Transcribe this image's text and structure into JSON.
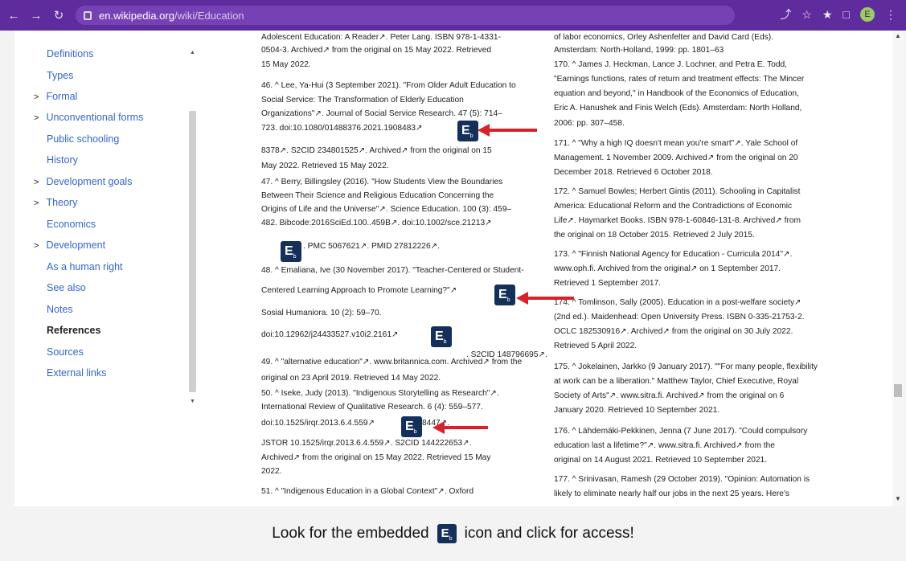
{
  "browser": {
    "url_host": "en.wikipedia.org",
    "url_path": "/wiki/Education",
    "avatar_letter": "E"
  },
  "toc": {
    "items": [
      {
        "label": "Definitions",
        "caret": false,
        "active": false
      },
      {
        "label": "Types",
        "caret": false,
        "active": false
      },
      {
        "label": "Formal",
        "caret": true,
        "active": false
      },
      {
        "label": "Unconventional forms",
        "caret": true,
        "active": false
      },
      {
        "label": "Public schooling",
        "caret": false,
        "active": false
      },
      {
        "label": "History",
        "caret": false,
        "active": false
      },
      {
        "label": "Development goals",
        "caret": true,
        "active": false
      },
      {
        "label": "Theory",
        "caret": true,
        "active": false
      },
      {
        "label": "Economics",
        "caret": false,
        "active": false
      },
      {
        "label": "Development",
        "caret": true,
        "active": false
      },
      {
        "label": "As a human right",
        "caret": false,
        "active": false
      },
      {
        "label": "See also",
        "caret": false,
        "active": false
      },
      {
        "label": "Notes",
        "caret": false,
        "active": false
      },
      {
        "label": "References",
        "caret": false,
        "active": true
      },
      {
        "label": "Sources",
        "caret": false,
        "active": false
      },
      {
        "label": "External links",
        "caret": false,
        "active": false
      }
    ]
  },
  "references": {
    "col1": [
      "Adolescent Education: A Reader↗. Peter Lang. ISBN 978-1-4331-",
      "0504-3. Archived↗ from the original on 15 May 2022. Retrieved",
      "15 May 2022.",
      "46. ^ Lee, Ya-Hui (3 September 2021). \"From Older Adult Education to",
      "Social Service: The Transformation of Elderly Education",
      "Organizations\"↗. Journal of Social Service Research. 47 (5): 714–",
      "723. doi:10.1080/01488376.2021.1908483↗",
      "8378↗. S2CID 234801525↗. Archived↗ from the original on 15",
      "May 2022. Retrieved 15 May 2022.",
      "47. ^ Berry, Billingsley (2016). \"How Students View the Boundaries",
      "Between Their Science and Religious Education Concerning the",
      "Origins of Life and the Universe\"↗. Science Education. 100 (3): 459–",
      "482. Bibcode:2016SciEd.100..459B↗. doi:10.1002/sce.21213↗",
      ". PMC 5067621↗. PMID 27812226↗.",
      "48. ^ Emaliana, Ive (30 November 2017). \"Teacher-Centered or Student-",
      "Centered Learning Approach to Promote Learning?\"↗",
      "Sosial Humaniora. 10 (2): 59–70.",
      "doi:10.12962/j24433527.v10i2.2161↗",
      ". S2CID 148796695↗.",
      "49. ^ \"alternative education\"↗. www.britannica.com. Archived↗ from the",
      "original on 23 April 2019. Retrieved 14 May 2022.",
      "50. ^ Iseke, Judy (2013). \"Indigenous Storytelling as Research\"↗.",
      "International Review of Qualitative Research. 6 (4): 559–577.",
      "doi:10.1525/irqr.2013.6.4.559↗",
      "8447↗.",
      "JSTOR 10.1525/irqr.2013.6.4.559↗. S2CID 144222653↗.",
      "Archived↗ from the original on 15 May 2022. Retrieved 15 May",
      "2022.",
      "51. ^ \"Indigenous Education in a Global Context\"↗. Oxford"
    ],
    "col2": [
      "of labor economics, Orley Ashenfelter and David Card (Eds).",
      "Amsterdam: North-Holland, 1999: pp. 1801–63",
      "170. ^ James J. Heckman, Lance J. Lochner, and Petra E. Todd,",
      "\"Earnings functions, rates of return and treatment effects: The Mincer",
      "equation and beyond,\" in Handbook of the Economics of Education,",
      "Eric A. Hanushek and Finis Welch (Eds). Amsterdam: North Holland,",
      "2006: pp. 307–458.",
      "171. ^ \"Why a high IQ doesn't mean you're smart\"↗. Yale School of",
      "Management. 1 November 2009. Archived↗ from the original on 20",
      "December 2018. Retrieved 6 October 2018.",
      "172. ^ Samuel Bowles; Herbert Gintis (2011). Schooling in Capitalist",
      "America: Educational Reform and the Contradictions of Economic",
      "Life↗. Haymarket Books. ISBN 978-1-60846-131-8. Archived↗ from",
      "the original on 18 October 2015. Retrieved 2 July 2015.",
      "173. ^ \"Finnish National Agency for Education - Curricula 2014\"↗.",
      "www.oph.fi. Archived from the original↗ on 1 September 2017.",
      "Retrieved 1 September 2017.",
      "174. ^ Tomlinson, Sally (2005). Education in a post-welfare society↗",
      "(2nd ed.). Maidenhead: Open University Press. ISBN 0-335-21753-2.",
      "OCLC 182530916↗. Archived↗ from the original on 30 July 2022.",
      "Retrieved 5 April 2022.",
      "175. ^ Jokelainen, Jarkko (9 January 2017). \"\"For many people, flexibility",
      "at work can be a liberation.\" Matthew Taylor, Chief Executive, Royal",
      "Society of Arts\"↗. www.sitra.fi. Archived↗ from the original on 6",
      "January 2020. Retrieved 10 September 2021.",
      "176. ^ Lähdemäki-Pekkinen, Jenna (7 June 2017). \"Could compulsory",
      "education last a lifetime?\"↗. www.sitra.fi. Archived↗ from the",
      "original on 14 August 2021. Retrieved 10 September 2021.",
      "177. ^ Srinivasan, Ramesh (29 October 2019). \"Opinion: Automation is",
      "likely to eliminate nearly half our jobs in the next 25 years. Here's"
    ]
  },
  "badge": {
    "letter": "E",
    "sub": "b"
  },
  "caption": {
    "before": "Look for the embedded",
    "after": "icon and click for access!"
  },
  "colors": {
    "toolbar": "#5f2c9e",
    "link": "#3366cc",
    "badge": "#14305a",
    "arrow": "#d9212b"
  }
}
